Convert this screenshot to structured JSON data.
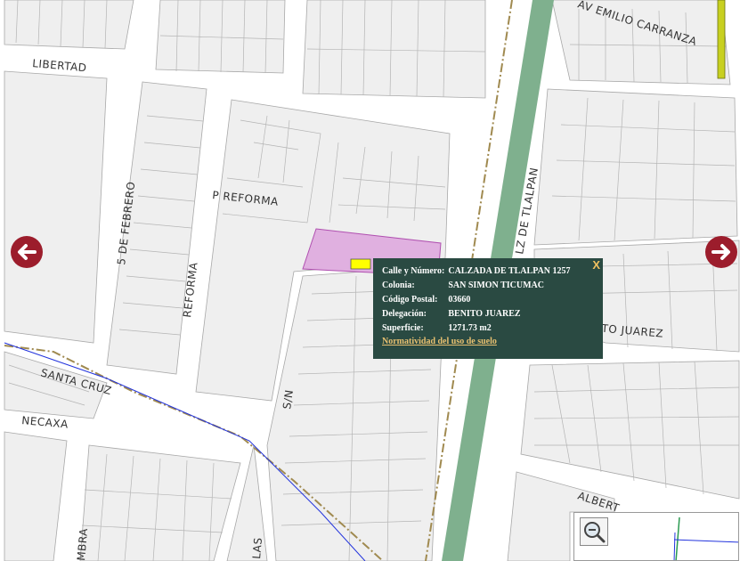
{
  "streets": {
    "libertad": "LIBERTAD",
    "av_emilio_carranza": "AV EMILIO CARRANZA",
    "p_reforma": "P REFORMA",
    "cinco_de_febrero": "5 DE FEBRERO",
    "reforma": "REFORMA",
    "calz_de_tlalpan": "LZ DE TLALPAN",
    "benito_juarez": "BENITO JUAREZ",
    "santa_cruz": "SANTA CRUZ",
    "necaxa": "NECAXA",
    "sn": "S/N",
    "albert": "ALBERT",
    "ambra": "MBRA",
    "las": "LAS"
  },
  "popup": {
    "rows": [
      {
        "label": "Calle y Número:",
        "value": "CALZADA DE TLALPAN 1257"
      },
      {
        "label": "Colonia:",
        "value": "SAN SIMON TICUMAC"
      },
      {
        "label": "Código Postal:",
        "value": "03660"
      },
      {
        "label": "Delegación:",
        "value": "BENITO JUAREZ"
      },
      {
        "label": "Superficie:",
        "value": "1271.73 m2"
      }
    ],
    "link": "Normatividad del uso de suelo",
    "close": "X"
  },
  "icons": {
    "prev": "left-arrow-icon",
    "next": "right-arrow-icon",
    "zoom_out": "magnifier-minus-icon"
  },
  "colors": {
    "parcel_highlight": "#e0b0e0",
    "marker": "#ffff00",
    "popup_bg": "#2a4a42",
    "nav_arrow": "#9c1d2c",
    "tlalpan_band": "#7fb08e"
  }
}
